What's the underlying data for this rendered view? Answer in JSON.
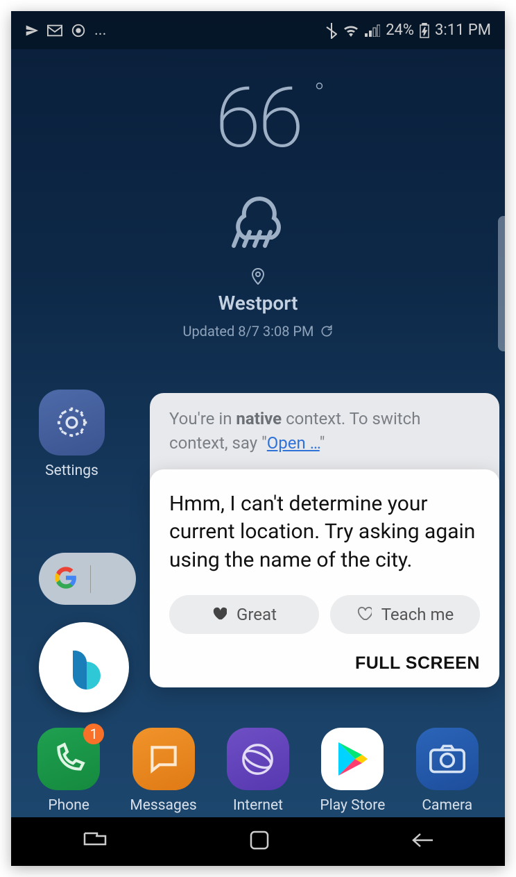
{
  "status_bar": {
    "battery_percent": "24%",
    "time": "3:11 PM"
  },
  "weather": {
    "temperature": "66",
    "location": "Westport",
    "updated": "Updated 8/7 3:08 PM"
  },
  "settings": {
    "label": "Settings"
  },
  "bixby_card": {
    "context_prefix": "You're in ",
    "context_bold": "native",
    "context_mid": " context. To switch context, say \"",
    "context_link": "Open …",
    "context_suffix": "\"",
    "message": "Hmm, I can't determine your current location. Try asking again using the name of the city.",
    "feedback_great": "Great",
    "feedback_teach": "Teach me",
    "fullscreen": "FULL SCREEN"
  },
  "dock": {
    "phone": {
      "label": "Phone",
      "badge": "1"
    },
    "messages": {
      "label": "Messages"
    },
    "internet": {
      "label": "Internet"
    },
    "play_store": {
      "label": "Play Store"
    },
    "camera": {
      "label": "Camera"
    }
  }
}
